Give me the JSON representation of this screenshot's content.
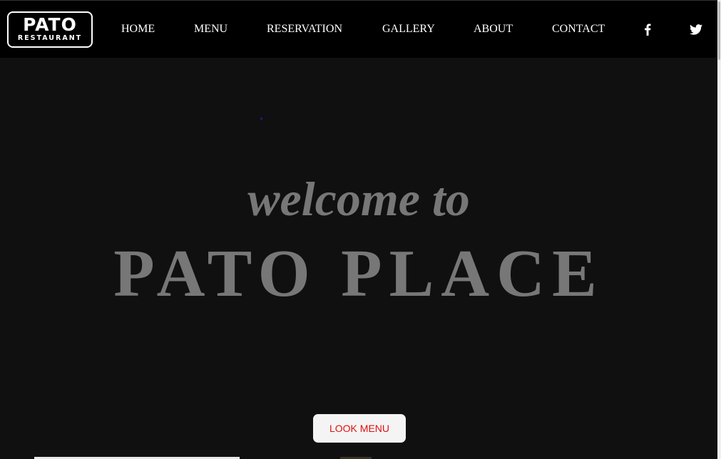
{
  "brand": {
    "name": "PATO",
    "tagline": "RESTAURANT"
  },
  "nav": {
    "items": [
      "HOME",
      "MENU",
      "RESERVATION",
      "GALLERY",
      "ABOUT",
      "CONTACT"
    ]
  },
  "social": {
    "icons": [
      "facebook-icon",
      "twitter-icon"
    ]
  },
  "hero": {
    "welcome": "welcome to",
    "title": "PATO PLACE",
    "button_label": "LOOK MENU"
  },
  "colors": {
    "navbar_bg": "#000000",
    "hero_bg": "#101010",
    "hero_text": "#777777",
    "button_bg": "#f4f4f4",
    "button_text": "#e01010"
  }
}
